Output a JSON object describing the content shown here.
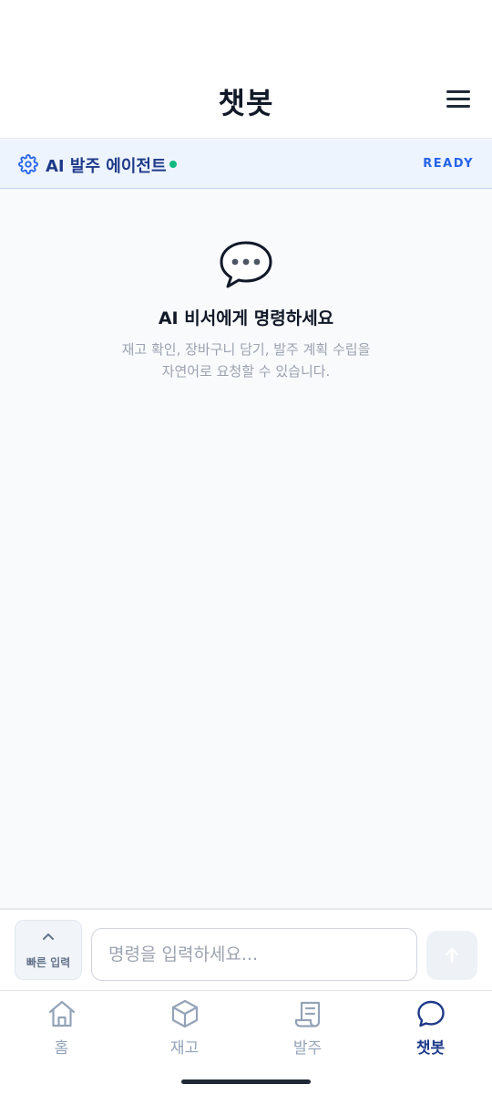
{
  "header": {
    "title": "챗봇",
    "menu_icon": "hamburger-menu-icon"
  },
  "agent": {
    "name": "AI 발주 에이전트",
    "status": "READY",
    "status_color": "#10b981",
    "icon": "gear-icon"
  },
  "empty_state": {
    "icon": "chat-bubble-icon",
    "title": "AI 비서에게 명령하세요",
    "description_line1": "재고 확인, 장바구니 담기, 발주 계획 수립을",
    "description_line2": "자연어로 요청할 수 있습니다."
  },
  "input_bar": {
    "quick_input_label": "빠른 입력",
    "placeholder": "명령을 입력하세요...",
    "value": "",
    "send_icon": "arrow-up-icon"
  },
  "nav": {
    "items": [
      {
        "label": "홈",
        "icon": "home-icon",
        "active": false
      },
      {
        "label": "재고",
        "icon": "box-icon",
        "active": false
      },
      {
        "label": "발주",
        "icon": "receipt-icon",
        "active": false
      },
      {
        "label": "챗봇",
        "icon": "chat-icon",
        "active": true
      }
    ]
  },
  "colors": {
    "accent": "#1e3a8a",
    "agent_bar_bg": "#eef4fd",
    "status_text": "#2563eb"
  }
}
